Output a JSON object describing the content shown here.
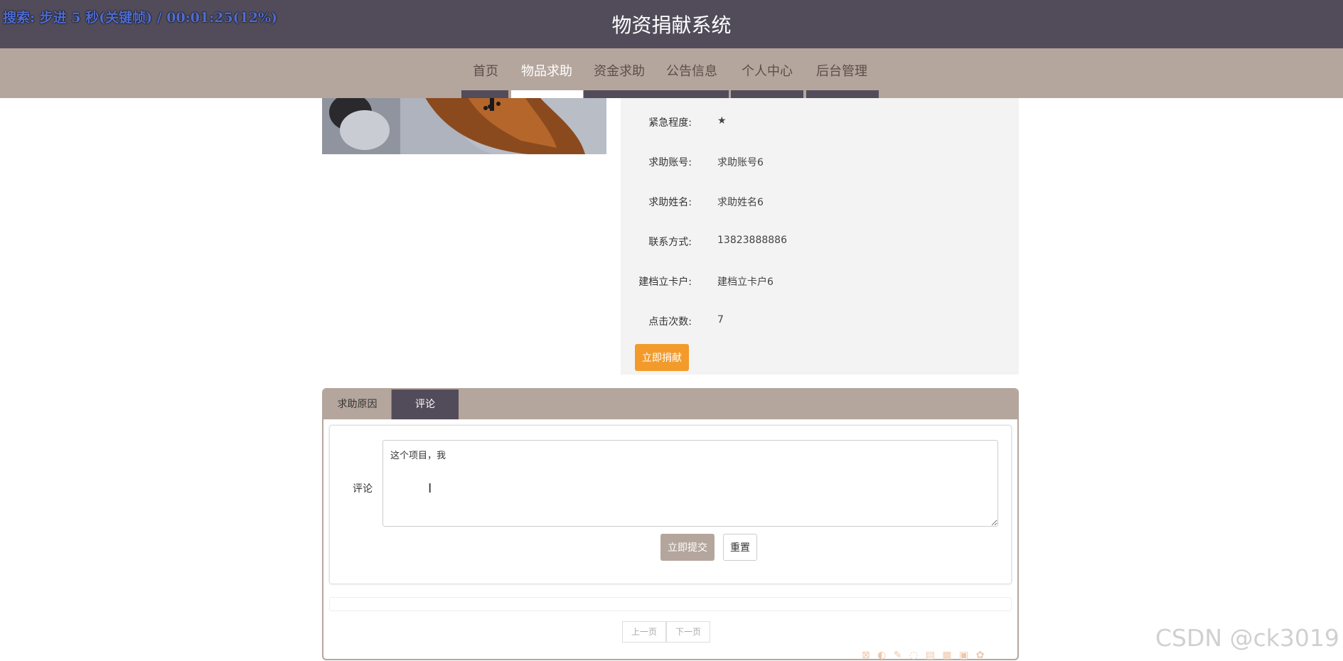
{
  "video_status": "搜索: 步进 5 秒(关键帧) / 00:01:25(12%)",
  "header": {
    "title": "物资捐献系统"
  },
  "nav": {
    "items": [
      {
        "label": "首页"
      },
      {
        "label": "物品求助"
      },
      {
        "label": "资金求助"
      },
      {
        "label": "公告信息"
      },
      {
        "label": "个人中心"
      },
      {
        "label": "后台管理"
      }
    ],
    "active": "物品求助"
  },
  "details": {
    "fields": [
      {
        "label": "紧急程度:",
        "value": "★"
      },
      {
        "label": "求助账号:",
        "value": "求助账号6"
      },
      {
        "label": "求助姓名:",
        "value": "求助姓名6"
      },
      {
        "label": "联系方式:",
        "value": "13823888886"
      },
      {
        "label": "建档立卡户:",
        "value": "建档立卡户6"
      },
      {
        "label": "点击次数:",
        "value": "7"
      }
    ],
    "donate_label": "立即捐献"
  },
  "tabs": [
    {
      "label": "求助原因",
      "active": false
    },
    {
      "label": "评论",
      "active": true
    }
  ],
  "comment_form": {
    "label": "评论",
    "value": "这个项目，我",
    "submit_label": "立即提交",
    "reset_label": "重置"
  },
  "pager": {
    "prev_label": "上一页",
    "next_label": "下一页"
  },
  "colors": {
    "header_bg": "#524c5a",
    "nav_bg": "#b5a69d",
    "accent": "#f29b2b"
  },
  "watermark": "CSDN @ck3019"
}
